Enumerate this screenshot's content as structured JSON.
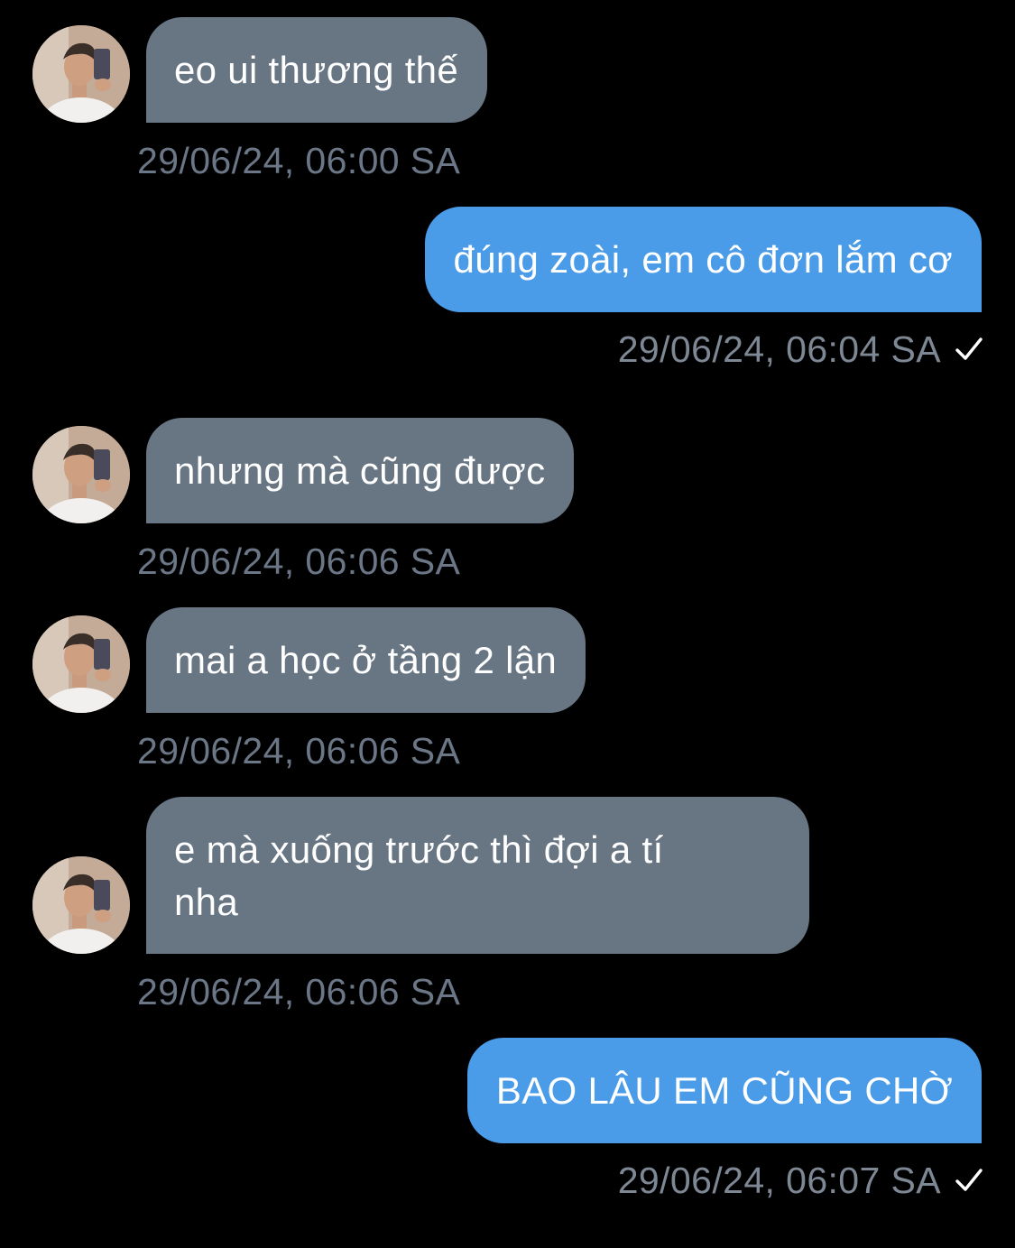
{
  "conversation": {
    "messages": [
      {
        "direction": "incoming",
        "text": "eo ui thương thế",
        "timestamp": "29/06/24, 06:00 SA"
      },
      {
        "direction": "outgoing",
        "text": "đúng zoài, em cô đơn lắm cơ",
        "timestamp": "29/06/24, 06:04 SA",
        "status_icon": "checkmark-icon"
      },
      {
        "direction": "incoming",
        "text": "nhưng mà cũng được",
        "timestamp": "29/06/24, 06:06 SA"
      },
      {
        "direction": "incoming",
        "text": "mai a học ở tầng 2 lận",
        "timestamp": "29/06/24, 06:06 SA"
      },
      {
        "direction": "incoming",
        "text": "e mà xuống trước thì đợi a tí\nnha",
        "timestamp": "29/06/24, 06:06 SA"
      },
      {
        "direction": "outgoing",
        "text": "BAO LÂU EM CŨNG CHỜ",
        "timestamp": "29/06/24, 06:07 SA",
        "status_icon": "checkmark-icon"
      }
    ]
  },
  "colors": {
    "background": "#000000",
    "incoming_bubble": "#687684",
    "outgoing_bubble": "#4a9be8",
    "timestamp": "#6b7786",
    "text": "#ffffff"
  },
  "icons": {
    "avatar": "avatar-photo",
    "sent_status": "checkmark-icon"
  }
}
